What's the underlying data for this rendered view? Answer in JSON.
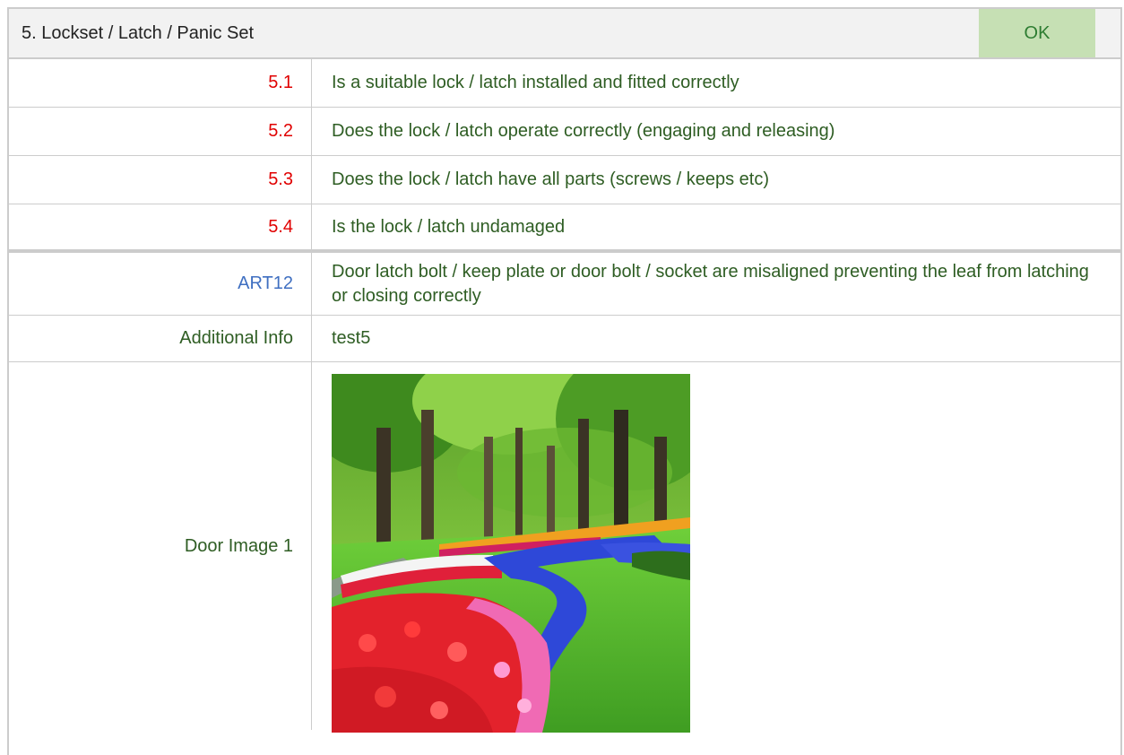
{
  "section": {
    "title": "5. Lockset / Latch / Panic Set",
    "status": "OK",
    "status_color": "#c6e0b4"
  },
  "checks": [
    {
      "number": "5.1",
      "text": "Is a suitable lock / latch installed and fitted correctly"
    },
    {
      "number": "5.2",
      "text": "Does the lock / latch operate correctly (engaging and releasing)"
    },
    {
      "number": "5.3",
      "text": "Does the lock / latch have all parts (screws / keeps etc)"
    },
    {
      "number": "5.4",
      "text": "Is the lock / latch undamaged"
    }
  ],
  "defect": {
    "code": "ART12",
    "description": "Door latch bolt / keep plate or door bolt / socket are misaligned preventing the leaf from latching or closing correctly"
  },
  "additional_info": {
    "label": "Additional Info",
    "value": "test5"
  },
  "door_image": {
    "label": "Door Image 1",
    "icon": "photo-tulip-garden"
  },
  "colors": {
    "check_number": "#e00000",
    "defect_code": "#3f6fc1",
    "text_green": "#2e5d23"
  }
}
